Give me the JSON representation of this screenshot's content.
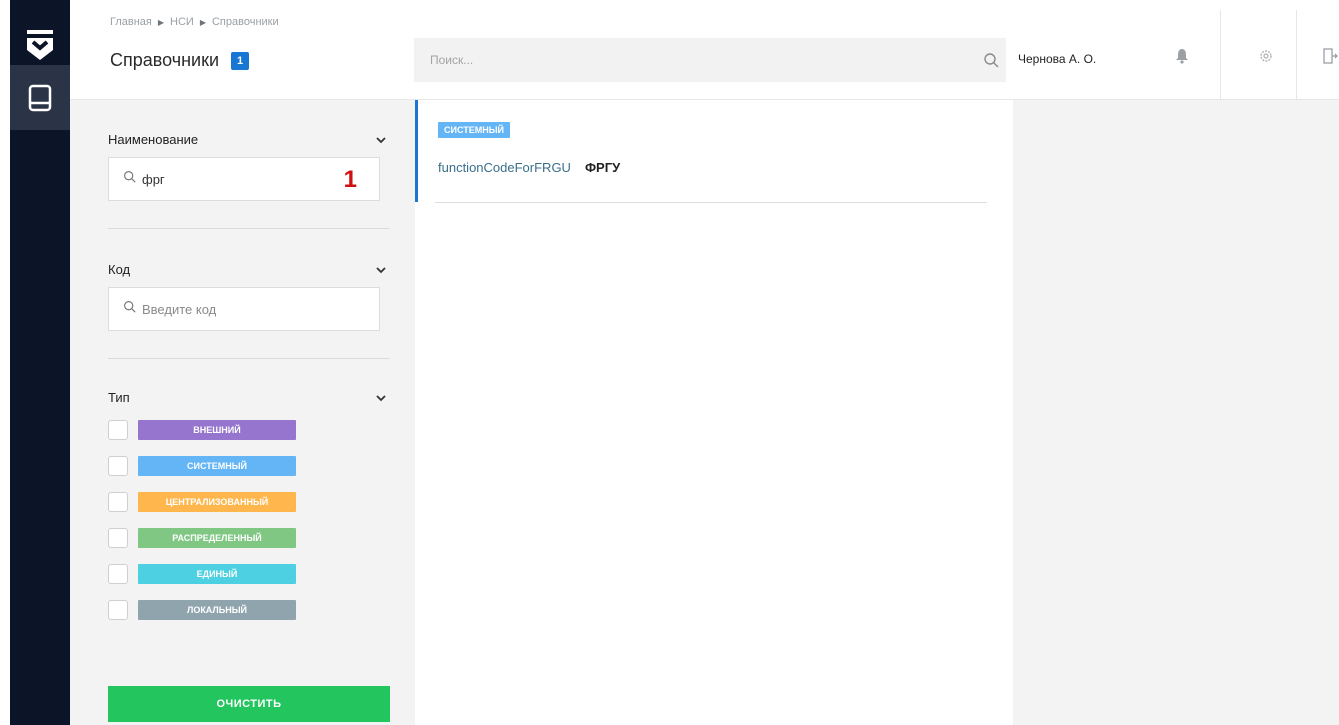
{
  "breadcrumb": [
    "Главная",
    "НСИ",
    "Справочники"
  ],
  "page": {
    "title": "Справочники",
    "count": "1"
  },
  "search": {
    "placeholder": "Поиск..."
  },
  "user": {
    "name": "Чернова А. О."
  },
  "filters": {
    "name": {
      "label": "Наименование",
      "value": "фрг",
      "annotation": "1"
    },
    "code": {
      "label": "Код",
      "placeholder": "Введите код",
      "value": ""
    },
    "type": {
      "label": "Тип",
      "options": [
        {
          "label": "ВНЕШНИЙ",
          "color": "#9575cd"
        },
        {
          "label": "СИСТЕМНЫЙ",
          "color": "#64b5f6"
        },
        {
          "label": "ЦЕНТРАЛИЗОВАННЫЙ",
          "color": "#ffb74d"
        },
        {
          "label": "РАСПРЕДЕЛЕННЫЙ",
          "color": "#81c784"
        },
        {
          "label": "ЕДИНЫЙ",
          "color": "#4dd0e1"
        },
        {
          "label": "ЛОКАЛЬНЫЙ",
          "color": "#90a4ae"
        }
      ]
    },
    "clear_label": "ОЧИСТИТЬ"
  },
  "results": [
    {
      "tag": "СИСТЕМНЫЙ",
      "code": "functionCodeForFRGU",
      "name": "ФРГУ"
    }
  ],
  "colors": {
    "accent": "#1976d2",
    "rail": "#0c1428",
    "clear": "#22c55e"
  }
}
